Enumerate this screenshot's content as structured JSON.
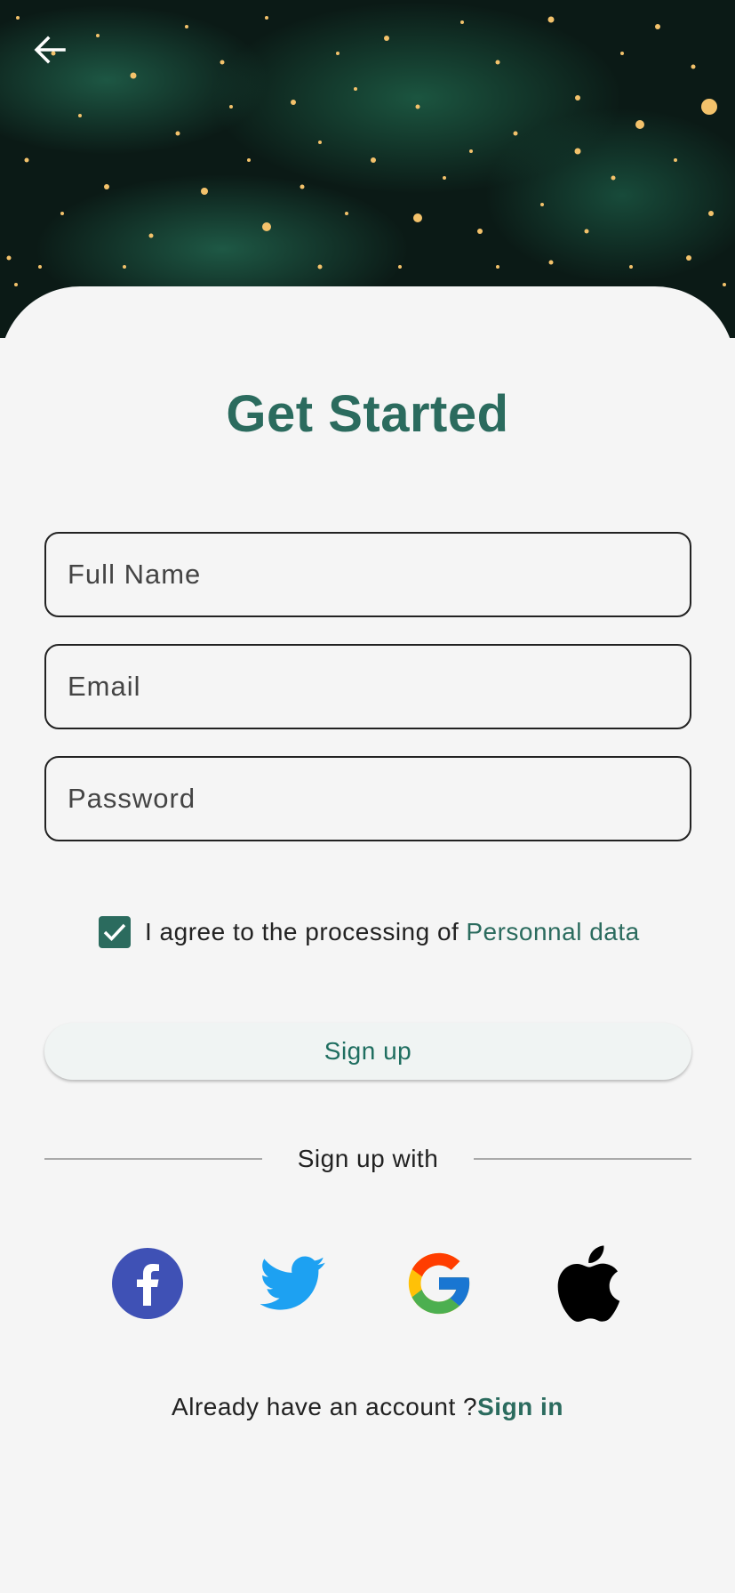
{
  "header": {
    "back_icon": "arrow-left-icon"
  },
  "title": "Get Started",
  "form": {
    "full_name_placeholder": "Full Name",
    "email_placeholder": "Email",
    "password_placeholder": "Password"
  },
  "agreement": {
    "checked": true,
    "text": "I agree to the processing of",
    "link": "Personnal data"
  },
  "signup_button": "Sign up",
  "divider_text": "Sign up with",
  "social": [
    {
      "name": "facebook-icon"
    },
    {
      "name": "twitter-icon"
    },
    {
      "name": "google-icon"
    },
    {
      "name": "apple-icon"
    }
  ],
  "footer": {
    "prompt": "Already have an account ?",
    "link": "Sign in"
  },
  "colors": {
    "accent": "#2b6b5e",
    "background": "#f5f5f5",
    "button_bg": "#f0f4f3"
  }
}
